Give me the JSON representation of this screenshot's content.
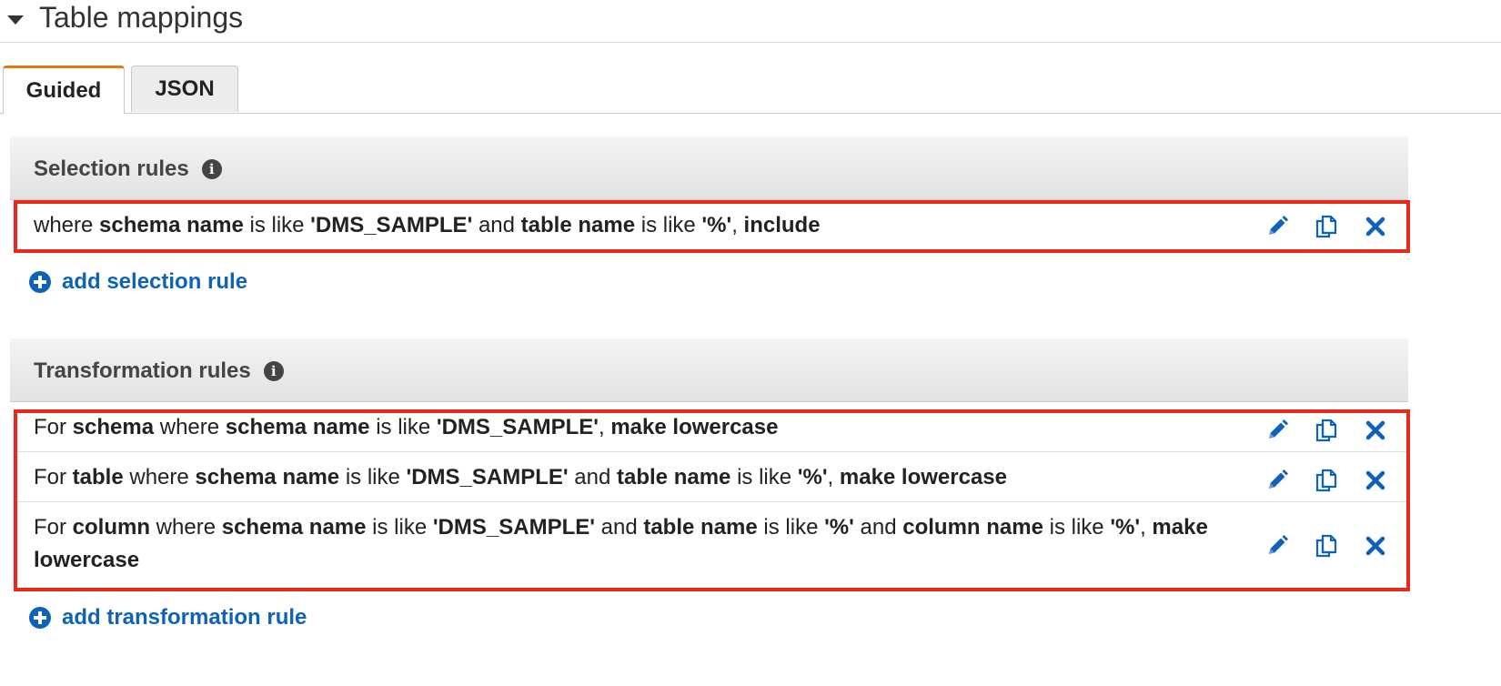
{
  "section": {
    "title": "Table mappings"
  },
  "tabs": [
    {
      "label": "Guided",
      "active": true
    },
    {
      "label": "JSON",
      "active": false
    }
  ],
  "selection": {
    "title": "Selection rules",
    "rules": [
      {
        "parts": [
          [
            "where ",
            false
          ],
          [
            "schema name",
            true
          ],
          [
            " is like ",
            false
          ],
          [
            "'DMS_SAMPLE'",
            true
          ],
          [
            " and ",
            false
          ],
          [
            "table name",
            true
          ],
          [
            " is like ",
            false
          ],
          [
            "'%'",
            true
          ],
          [
            ", ",
            false
          ],
          [
            "include",
            true
          ]
        ]
      }
    ],
    "add_label": "add selection rule"
  },
  "transformation": {
    "title": "Transformation rules",
    "rules": [
      {
        "parts": [
          [
            "For ",
            false
          ],
          [
            "schema",
            true
          ],
          [
            " where ",
            false
          ],
          [
            "schema name",
            true
          ],
          [
            " is like ",
            false
          ],
          [
            "'DMS_SAMPLE'",
            true
          ],
          [
            ", ",
            false
          ],
          [
            "make lowercase",
            true
          ]
        ]
      },
      {
        "parts": [
          [
            "For ",
            false
          ],
          [
            "table",
            true
          ],
          [
            " where ",
            false
          ],
          [
            "schema name",
            true
          ],
          [
            " is like ",
            false
          ],
          [
            "'DMS_SAMPLE'",
            true
          ],
          [
            " and ",
            false
          ],
          [
            "table name",
            true
          ],
          [
            " is like ",
            false
          ],
          [
            "'%'",
            true
          ],
          [
            ", ",
            false
          ],
          [
            "make lowercase",
            true
          ]
        ]
      },
      {
        "parts": [
          [
            "For ",
            false
          ],
          [
            "column",
            true
          ],
          [
            " where ",
            false
          ],
          [
            "schema name",
            true
          ],
          [
            " is like ",
            false
          ],
          [
            "'DMS_SAMPLE'",
            true
          ],
          [
            " and ",
            false
          ],
          [
            "table name",
            true
          ],
          [
            " is like ",
            false
          ],
          [
            "'%'",
            true
          ],
          [
            " and ",
            false
          ],
          [
            "column name",
            true
          ],
          [
            " is like ",
            false
          ],
          [
            "'%'",
            true
          ],
          [
            ", ",
            false
          ],
          [
            "make lowercase",
            true
          ]
        ]
      }
    ],
    "add_label": "add transformation rule"
  },
  "icons": {
    "expand": "caret-down-icon",
    "info": "info-icon",
    "edit": "pencil-icon",
    "copy": "copy-icon",
    "delete": "close-icon",
    "add": "plus-circle-icon"
  },
  "colors": {
    "link": "#0e63b8",
    "highlight": "#e8291c",
    "active_tab_accent": "#e47911"
  }
}
